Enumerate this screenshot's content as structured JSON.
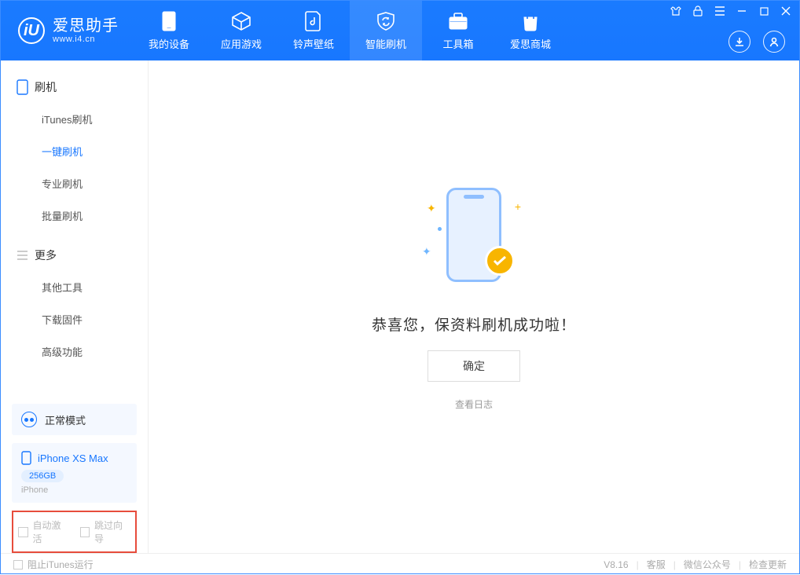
{
  "brand": {
    "name": "爱思助手",
    "url": "www.i4.cn",
    "logo_letter": "iU"
  },
  "nav": {
    "items": [
      {
        "label": "我的设备"
      },
      {
        "label": "应用游戏"
      },
      {
        "label": "铃声壁纸"
      },
      {
        "label": "智能刷机"
      },
      {
        "label": "工具箱"
      },
      {
        "label": "爱思商城"
      }
    ],
    "active_index": 3
  },
  "sidebar": {
    "groups": [
      {
        "title": "刷机",
        "items": [
          {
            "label": "iTunes刷机"
          },
          {
            "label": "一键刷机"
          },
          {
            "label": "专业刷机"
          },
          {
            "label": "批量刷机"
          }
        ],
        "active_index": 1
      },
      {
        "title": "更多",
        "items": [
          {
            "label": "其他工具"
          },
          {
            "label": "下载固件"
          },
          {
            "label": "高级功能"
          }
        ]
      }
    ],
    "mode": {
      "label": "正常模式"
    },
    "device": {
      "name": "iPhone XS Max",
      "storage": "256GB",
      "type": "iPhone"
    },
    "options": {
      "auto_activate": "自动激活",
      "skip_guide": "跳过向导"
    }
  },
  "content": {
    "success_text": "恭喜您，保资料刷机成功啦！",
    "ok_button": "确定",
    "view_log": "查看日志"
  },
  "footer": {
    "block_itunes": "阻止iTunes运行",
    "version": "V8.16",
    "links": {
      "support": "客服",
      "wechat": "微信公众号",
      "check_update": "检查更新"
    }
  }
}
